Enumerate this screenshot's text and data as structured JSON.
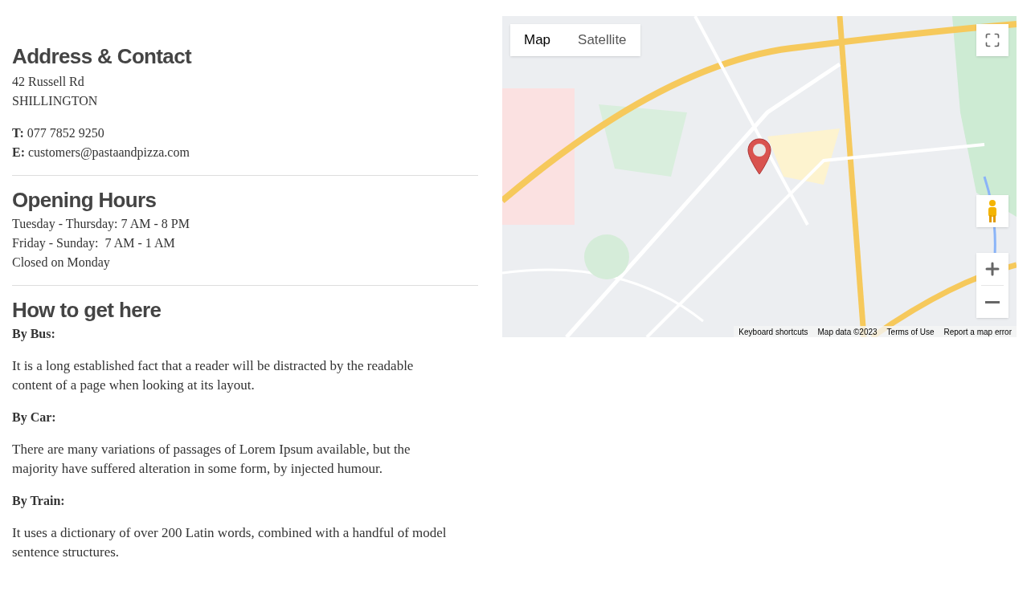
{
  "address": {
    "title": "Address & Contact",
    "lines": [
      "42 Russell Rd",
      "SHILLINGTON"
    ],
    "contacts": [
      {
        "label": "T:",
        "value": "077 7852 9250"
      },
      {
        "label": "E:",
        "value": "customers@pastaandpizza.com"
      }
    ]
  },
  "hours": {
    "title": "Opening Hours",
    "lines": [
      "Tuesday - Thursday: 7 AM - 8 PM",
      "Friday - Sunday:  7 AM - 1 AM",
      "Closed on Monday"
    ]
  },
  "directions": {
    "title": "How to get here",
    "sections": [
      {
        "heading": "By Bus:",
        "text": "It is a long established fact that a reader will be distracted by the readable content of a page when looking at its layout."
      },
      {
        "heading": "By Car:",
        "text": "There are many variations of passages of Lorem Ipsum available, but the majority have suffered alteration in some form, by injected humour."
      },
      {
        "heading": "By Train:",
        "text": "It uses a dictionary of over 200 Latin words, combined with a handful of model sentence structures."
      }
    ]
  },
  "map": {
    "kind": "picture",
    "map_types": [
      {
        "label": "Map",
        "selected": true
      },
      {
        "label": "Satellite",
        "selected": false
      }
    ],
    "footer": [
      "Keyboard shortcuts",
      "Map data ©2023",
      "Terms of Use",
      "Report a map error"
    ]
  }
}
